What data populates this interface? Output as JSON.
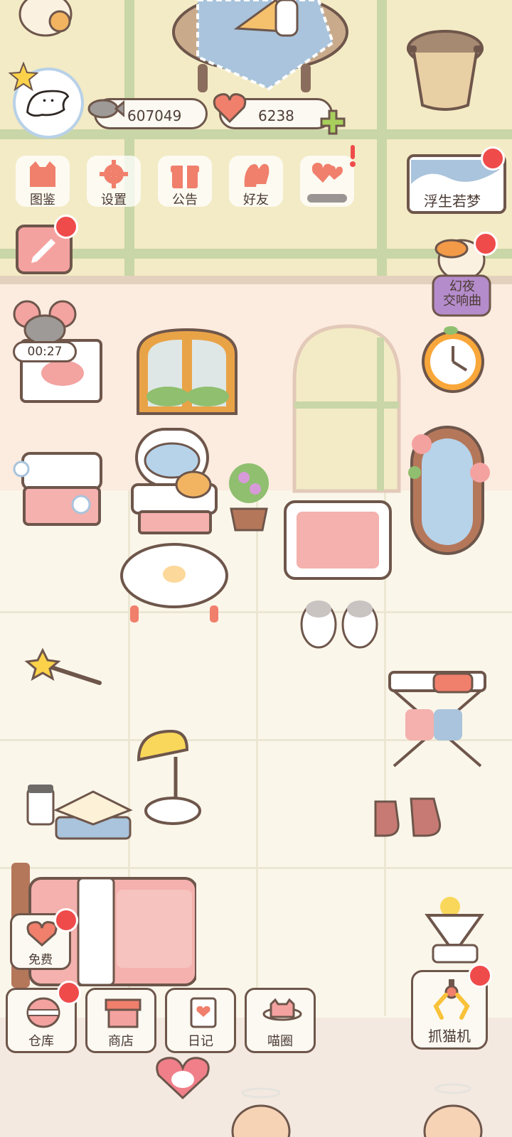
{
  "resources": {
    "fish_count": "607049",
    "heart_count": "6238"
  },
  "top_menu": [
    {
      "label": "图鉴",
      "icon": "cat-head-icon"
    },
    {
      "label": "设置",
      "icon": "gear-icon"
    },
    {
      "label": "公告",
      "icon": "gift-icon"
    },
    {
      "label": "好友",
      "icon": "friends-icon"
    }
  ],
  "events": {
    "dream_label": "浮生若梦",
    "night_label_line1": "幻夜",
    "night_label_line2": "交响曲"
  },
  "timer": {
    "value": "00:27"
  },
  "free_button": {
    "label": "免费"
  },
  "bottom_nav": [
    {
      "label": "仓库",
      "icon": "storage-icon"
    },
    {
      "label": "商店",
      "icon": "shop-icon"
    },
    {
      "label": "日记",
      "icon": "diary-icon"
    },
    {
      "label": "喵圈",
      "icon": "cat-planet-icon"
    }
  ],
  "claw_machine": {
    "label": "抓猫机",
    "icon": "claw-icon"
  },
  "colors": {
    "upper_wall": "#f3ebc5",
    "lower_wall": "#fcebdf",
    "floor": "#fbf6ea",
    "accent_pink": "#f07f6c",
    "badge_red": "#ef4b4b",
    "outline": "#6e564b"
  }
}
